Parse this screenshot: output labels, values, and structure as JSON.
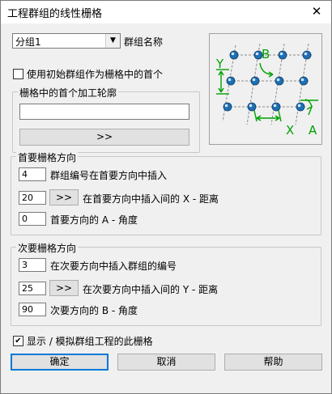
{
  "window": {
    "title": "工程群组的线性栅格",
    "close_symbol": "✕"
  },
  "group_select": {
    "value": "分组1",
    "label": "群组名称"
  },
  "initial_contour": {
    "checkbox_label": "使用初始群组作为栅格中的首个",
    "checked": false,
    "section_title": "栅格中的首个加工轮廓",
    "input_value": "",
    "pick_button": ">>"
  },
  "primary": {
    "section_title": "首要栅格方向",
    "count_value": "4",
    "count_label": "群组编号在首要方向中插入",
    "distance_value": "20",
    "distance_button": ">>",
    "distance_label": "在首要方向中插入间的 X - 距离",
    "angle_value": "0",
    "angle_label": "首要方向的 A - 角度"
  },
  "secondary": {
    "section_title": "次要栅格方向",
    "count_value": "3",
    "count_label": "在次要方向中插入群组的编号",
    "distance_value": "25",
    "distance_button": ">>",
    "distance_label": "在次要方向中插入间的 Y - 距离",
    "angle_value": "90",
    "angle_label": "次要方向的 B - 角度"
  },
  "simulate": {
    "label": "显示 / 模拟群组工程的此栅格",
    "checked": true
  },
  "buttons": {
    "ok": "确定",
    "cancel": "取消",
    "help": "帮助"
  },
  "preview": {
    "label_x": "X",
    "label_y": "Y",
    "label_a": "A",
    "label_b": "B",
    "accent_color": "#00a000",
    "dot_color": "#1e6fb4"
  }
}
